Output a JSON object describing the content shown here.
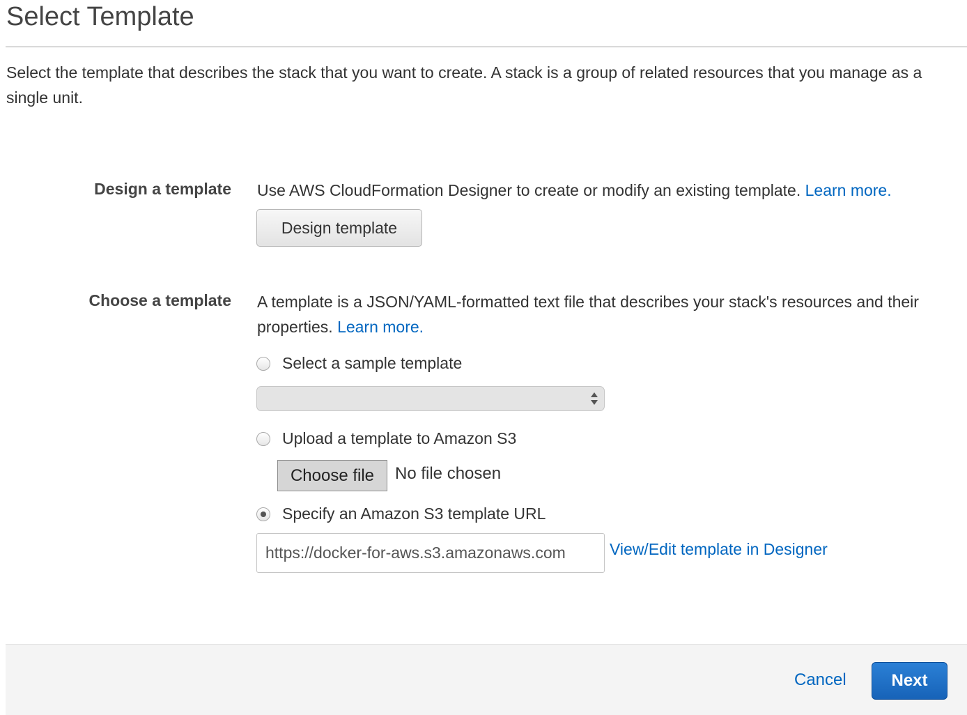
{
  "page": {
    "title": "Select Template",
    "intro": "Select the template that describes the stack that you want to create. A stack is a group of related resources that you manage as a single unit."
  },
  "design_section": {
    "label": "Design a template",
    "description": "Use AWS CloudFormation Designer to create or modify an existing template.",
    "learn_more": "Learn more.",
    "button_label": "Design template"
  },
  "choose_section": {
    "label": "Choose a template",
    "description": "A template is a JSON/YAML-formatted text file that describes your stack's resources and their properties.",
    "learn_more": "Learn more.",
    "options": {
      "sample": {
        "label": "Select a sample template",
        "checked": false,
        "selected_value": ""
      },
      "upload": {
        "label": "Upload a template to Amazon S3",
        "checked": false,
        "file_button": "Choose file",
        "file_status": "No file chosen"
      },
      "url": {
        "label": "Specify an Amazon S3 template URL",
        "checked": true,
        "value": "https://docker-for-aws.s3.amazonaws.com",
        "designer_link": "View/Edit template in Designer"
      }
    }
  },
  "footer": {
    "cancel_label": "Cancel",
    "next_label": "Next"
  },
  "colors": {
    "link": "#0066c0",
    "primary_button": "#1f6fc5"
  }
}
